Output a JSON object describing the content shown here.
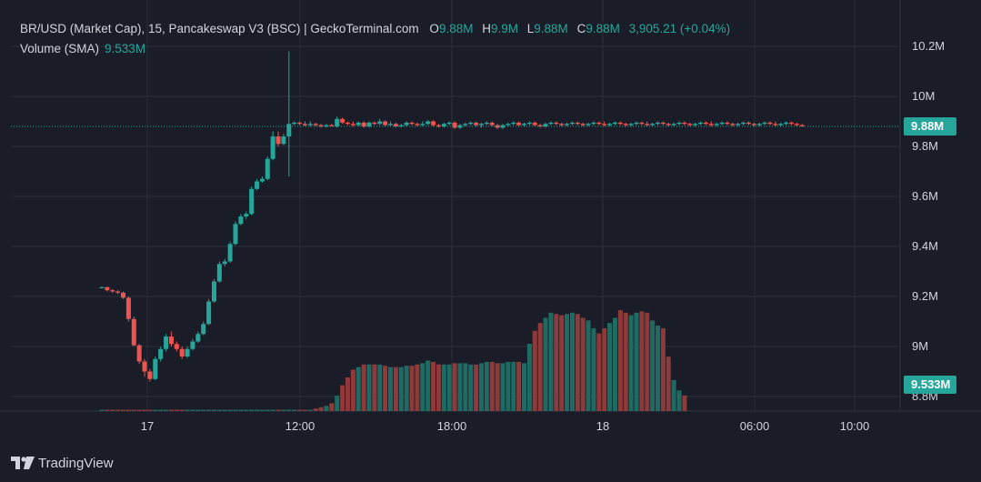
{
  "legend": {
    "title": "BR/USD (Market Cap), 15, Pancakeswap V3 (BSC) | GeckoTerminal.com",
    "o_label": "O",
    "o_value": "9.88M",
    "h_label": "H",
    "h_value": "9.9M",
    "l_label": "L",
    "l_value": "9.88M",
    "c_label": "C",
    "c_value": "9.88M",
    "change": "3,905.21 (+0.04%)",
    "volume_label": "Volume (SMA)",
    "volume_value": "9.533M"
  },
  "price_badge": "9.88M",
  "volume_badge": "9.533M",
  "footer": {
    "brand": "TradingView"
  },
  "colors": {
    "up": "#26a69a",
    "down": "#ef5350",
    "background": "#1a1d27",
    "grid": "#2a2e39"
  },
  "chart_data": {
    "type": "candlestick",
    "y_axis": {
      "ticks": [
        "10.2M",
        "10M",
        "9.8M",
        "9.6M",
        "9.4M",
        "9.2M",
        "9M",
        "8.8M"
      ],
      "tick_values": [
        10.2,
        10.0,
        9.8,
        9.6,
        9.4,
        9.2,
        9.0,
        8.8
      ],
      "range": [
        8.76,
        10.3
      ]
    },
    "x_axis": {
      "ticks": [
        "17",
        "12:00",
        "18:00",
        "18",
        "06:00",
        "10:00"
      ]
    },
    "candles": [
      [
        9.237,
        9.24,
        9.235,
        9.237
      ],
      [
        9.237,
        9.24,
        9.22,
        9.225
      ],
      [
        9.225,
        9.23,
        9.215,
        9.22
      ],
      [
        9.22,
        9.225,
        9.21,
        9.215
      ],
      [
        9.215,
        9.22,
        9.19,
        9.195
      ],
      [
        9.195,
        9.2,
        9.1,
        9.11
      ],
      [
        9.11,
        9.12,
        9.0,
        9.005
      ],
      [
        9.005,
        9.01,
        8.93,
        8.94
      ],
      [
        8.94,
        8.95,
        8.88,
        8.9
      ],
      [
        8.9,
        8.91,
        8.86,
        8.87
      ],
      [
        8.87,
        8.96,
        8.865,
        8.95
      ],
      [
        8.95,
        9.0,
        8.94,
        8.99
      ],
      [
        8.99,
        9.05,
        8.98,
        9.04
      ],
      [
        9.04,
        9.06,
        9.0,
        9.01
      ],
      [
        9.01,
        9.02,
        8.98,
        8.99
      ],
      [
        8.99,
        9.0,
        8.95,
        8.96
      ],
      [
        8.96,
        9.0,
        8.955,
        8.99
      ],
      [
        8.99,
        9.03,
        8.985,
        9.02
      ],
      [
        9.02,
        9.06,
        9.015,
        9.05
      ],
      [
        9.05,
        9.1,
        9.045,
        9.09
      ],
      [
        9.09,
        9.19,
        9.085,
        9.18
      ],
      [
        9.18,
        9.27,
        9.175,
        9.26
      ],
      [
        9.26,
        9.34,
        9.255,
        9.33
      ],
      [
        9.33,
        9.35,
        9.32,
        9.34
      ],
      [
        9.34,
        9.42,
        9.335,
        9.41
      ],
      [
        9.41,
        9.5,
        9.405,
        9.49
      ],
      [
        9.49,
        9.53,
        9.485,
        9.52
      ],
      [
        9.52,
        9.54,
        9.51,
        9.53
      ],
      [
        9.53,
        9.64,
        9.525,
        9.63
      ],
      [
        9.63,
        9.67,
        9.625,
        9.66
      ],
      [
        9.66,
        9.68,
        9.655,
        9.67
      ],
      [
        9.67,
        9.76,
        9.665,
        9.75
      ],
      [
        9.75,
        9.86,
        9.745,
        9.84
      ],
      [
        9.84,
        9.86,
        9.8,
        9.81
      ],
      [
        9.81,
        9.85,
        9.805,
        9.84
      ],
      [
        9.84,
        10.18,
        9.68,
        9.89
      ],
      [
        9.89,
        9.9,
        9.885,
        9.895
      ],
      [
        9.895,
        9.9,
        9.885,
        9.89
      ],
      [
        9.89,
        9.9,
        9.88,
        9.885
      ],
      [
        9.885,
        9.9,
        9.88,
        9.89
      ],
      [
        9.89,
        9.895,
        9.88,
        9.885
      ],
      [
        9.885,
        9.89,
        9.875,
        9.88
      ],
      [
        9.88,
        9.89,
        9.875,
        9.885
      ],
      [
        9.885,
        9.89,
        9.88,
        9.88
      ],
      [
        9.88,
        9.92,
        9.875,
        9.91
      ],
      [
        9.91,
        9.915,
        9.89,
        9.895
      ],
      [
        9.895,
        9.9,
        9.885,
        9.89
      ],
      [
        9.89,
        9.9,
        9.88,
        9.885
      ],
      [
        9.885,
        9.9,
        9.88,
        9.895
      ],
      [
        9.895,
        9.9,
        9.875,
        9.88
      ],
      [
        9.88,
        9.9,
        9.875,
        9.895
      ],
      [
        9.895,
        9.9,
        9.885,
        9.89
      ],
      [
        9.89,
        9.91,
        9.885,
        9.9
      ],
      [
        9.9,
        9.905,
        9.88,
        9.885
      ],
      [
        9.885,
        9.9,
        9.88,
        9.89
      ],
      [
        9.89,
        9.895,
        9.875,
        9.88
      ],
      [
        9.88,
        9.89,
        9.875,
        9.885
      ],
      [
        9.885,
        9.9,
        9.88,
        9.895
      ],
      [
        9.895,
        9.9,
        9.885,
        9.89
      ],
      [
        9.89,
        9.895,
        9.88,
        9.885
      ],
      [
        9.885,
        9.9,
        9.88,
        9.89
      ],
      [
        9.89,
        9.905,
        9.885,
        9.9
      ],
      [
        9.9,
        9.905,
        9.88,
        9.885
      ],
      [
        9.885,
        9.89,
        9.875,
        9.88
      ],
      [
        9.88,
        9.895,
        9.875,
        9.89
      ],
      [
        9.89,
        9.9,
        9.885,
        9.895
      ],
      [
        9.895,
        9.9,
        9.87,
        9.875
      ],
      [
        9.875,
        9.89,
        9.87,
        9.885
      ],
      [
        9.885,
        9.895,
        9.88,
        9.89
      ],
      [
        9.89,
        9.9,
        9.885,
        9.895
      ],
      [
        9.895,
        9.9,
        9.88,
        9.885
      ],
      [
        9.885,
        9.895,
        9.875,
        9.89
      ],
      [
        9.89,
        9.9,
        9.885,
        9.895
      ],
      [
        9.895,
        9.9,
        9.88,
        9.885
      ],
      [
        9.885,
        9.89,
        9.87,
        9.875
      ],
      [
        9.875,
        9.89,
        9.87,
        9.885
      ],
      [
        9.885,
        9.895,
        9.88,
        9.89
      ],
      [
        9.89,
        9.9,
        9.885,
        9.895
      ],
      [
        9.895,
        9.9,
        9.88,
        9.885
      ],
      [
        9.885,
        9.895,
        9.88,
        9.89
      ],
      [
        9.89,
        9.9,
        9.885,
        9.895
      ],
      [
        9.895,
        9.9,
        9.88,
        9.885
      ],
      [
        9.885,
        9.89,
        9.875,
        9.88
      ],
      [
        9.88,
        9.895,
        9.875,
        9.89
      ],
      [
        9.89,
        9.9,
        9.885,
        9.895
      ],
      [
        9.895,
        9.9,
        9.885,
        9.89
      ],
      [
        9.89,
        9.895,
        9.88,
        9.885
      ],
      [
        9.885,
        9.895,
        9.88,
        9.89
      ],
      [
        9.89,
        9.9,
        9.885,
        9.895
      ],
      [
        9.895,
        9.9,
        9.885,
        9.89
      ],
      [
        9.89,
        9.895,
        9.88,
        9.885
      ],
      [
        9.885,
        9.895,
        9.88,
        9.89
      ],
      [
        9.89,
        9.9,
        9.885,
        9.895
      ],
      [
        9.895,
        9.9,
        9.885,
        9.89
      ],
      [
        9.89,
        9.9,
        9.88,
        9.885
      ],
      [
        9.885,
        9.895,
        9.88,
        9.89
      ],
      [
        9.89,
        9.9,
        9.885,
        9.895
      ],
      [
        9.895,
        9.9,
        9.885,
        9.89
      ],
      [
        9.89,
        9.895,
        9.88,
        9.885
      ],
      [
        9.885,
        9.895,
        9.88,
        9.89
      ],
      [
        9.89,
        9.9,
        9.885,
        9.895
      ],
      [
        9.895,
        9.9,
        9.885,
        9.89
      ],
      [
        9.89,
        9.9,
        9.88,
        9.885
      ],
      [
        9.885,
        9.895,
        9.88,
        9.89
      ],
      [
        9.89,
        9.9,
        9.885,
        9.895
      ],
      [
        9.895,
        9.9,
        9.885,
        9.89
      ],
      [
        9.89,
        9.895,
        9.88,
        9.885
      ],
      [
        9.885,
        9.895,
        9.88,
        9.89
      ],
      [
        9.89,
        9.9,
        9.885,
        9.895
      ],
      [
        9.895,
        9.9,
        9.885,
        9.89
      ],
      [
        9.89,
        9.895,
        9.88,
        9.885
      ],
      [
        9.885,
        9.895,
        9.88,
        9.89
      ],
      [
        9.89,
        9.9,
        9.885,
        9.895
      ],
      [
        9.895,
        9.9,
        9.885,
        9.89
      ],
      [
        9.89,
        9.9,
        9.88,
        9.885
      ],
      [
        9.885,
        9.895,
        9.88,
        9.89
      ],
      [
        9.89,
        9.9,
        9.885,
        9.895
      ],
      [
        9.895,
        9.9,
        9.885,
        9.89
      ],
      [
        9.89,
        9.895,
        9.88,
        9.885
      ],
      [
        9.885,
        9.895,
        9.88,
        9.89
      ],
      [
        9.89,
        9.9,
        9.885,
        9.895
      ],
      [
        9.895,
        9.9,
        9.885,
        9.89
      ],
      [
        9.89,
        9.895,
        9.88,
        9.885
      ],
      [
        9.885,
        9.895,
        9.88,
        9.89
      ],
      [
        9.89,
        9.9,
        9.885,
        9.895
      ],
      [
        9.895,
        9.9,
        9.885,
        9.89
      ],
      [
        9.89,
        9.9,
        9.88,
        9.885
      ],
      [
        9.885,
        9.895,
        9.88,
        9.89
      ],
      [
        9.89,
        9.9,
        9.885,
        9.895
      ],
      [
        9.895,
        9.9,
        9.885,
        9.89
      ],
      [
        9.89,
        9.895,
        9.88,
        9.885
      ],
      [
        9.885,
        9.89,
        9.88,
        9.88
      ]
    ],
    "volume": {
      "name": "Volume (SMA)",
      "values": [
        0.05,
        0.05,
        0.05,
        0.05,
        0.05,
        0.05,
        0.05,
        0.05,
        0.05,
        0.05,
        0.05,
        0.05,
        0.05,
        0.05,
        0.05,
        0.05,
        0.05,
        0.05,
        0.05,
        0.05,
        0.05,
        0.05,
        0.05,
        0.05,
        0.05,
        0.05,
        0.05,
        0.05,
        0.05,
        0.05,
        0.05,
        0.05,
        0.05,
        0.05,
        0.05,
        0.05,
        0.05,
        0.05,
        0.05,
        0.05,
        0.1,
        0.15,
        0.2,
        0.3,
        0.6,
        1.0,
        1.3,
        1.6,
        1.7,
        1.8,
        1.8,
        1.8,
        1.8,
        1.75,
        1.7,
        1.7,
        1.7,
        1.75,
        1.75,
        1.8,
        1.85,
        1.95,
        1.9,
        1.8,
        1.8,
        1.8,
        1.85,
        1.85,
        1.85,
        1.8,
        1.8,
        1.85,
        1.9,
        1.9,
        1.85,
        1.85,
        1.9,
        1.9,
        1.9,
        1.85,
        2.6,
        3.1,
        3.4,
        3.6,
        3.8,
        3.75,
        3.7,
        3.75,
        3.8,
        3.75,
        3.6,
        3.5,
        3.2,
        3.0,
        3.2,
        3.4,
        3.6,
        3.9,
        3.8,
        3.7,
        3.8,
        3.85,
        3.8,
        3.5,
        3.3,
        3.2,
        2.1,
        1.2,
        0.8,
        0.6
      ]
    }
  }
}
